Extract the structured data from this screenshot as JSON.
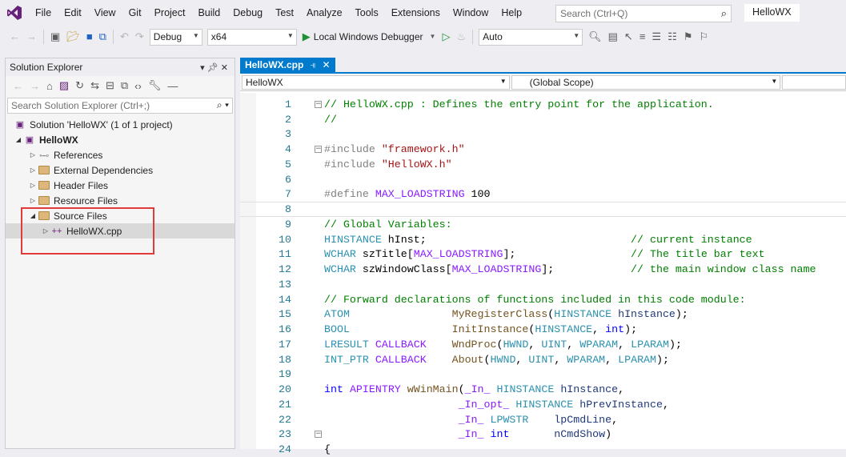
{
  "menubar": {
    "items": [
      "File",
      "Edit",
      "View",
      "Git",
      "Project",
      "Build",
      "Debug",
      "Test",
      "Analyze",
      "Tools",
      "Extensions",
      "Window",
      "Help"
    ],
    "search_placeholder": "Search (Ctrl+Q)",
    "solution_name": "HelloWX"
  },
  "toolbar": {
    "config": "Debug",
    "platform": "x64",
    "run_label": "Local Windows Debugger",
    "auto_label": "Auto"
  },
  "solution_explorer": {
    "title": "Solution Explorer",
    "search_placeholder": "Search Solution Explorer (Ctrl+;)",
    "solution_label": "Solution 'HelloWX' (1 of 1 project)",
    "project_label": "HelloWX",
    "nodes": [
      {
        "label": "References",
        "icon": "references-icon"
      },
      {
        "label": "External Dependencies",
        "icon": "folder-icon"
      },
      {
        "label": "Header Files",
        "icon": "folder-icon"
      },
      {
        "label": "Resource Files",
        "icon": "folder-icon"
      },
      {
        "label": "Source Files",
        "icon": "folder-icon"
      }
    ],
    "selected_file": "HelloWX.cpp"
  },
  "editor": {
    "tab_label": "HelloWX.cpp",
    "nav_project": "HelloWX",
    "nav_scope": "(Global Scope)",
    "line_numbers": [
      "1",
      "2",
      "3",
      "4",
      "5",
      "6",
      "7",
      "8",
      "9",
      "10",
      "11",
      "12",
      "13",
      "14",
      "15",
      "16",
      "17",
      "18",
      "19",
      "20",
      "21",
      "22",
      "23",
      "24"
    ],
    "lines": [
      [
        [
          "c-com",
          "// HelloWX.cpp : Defines the entry point for the application."
        ]
      ],
      [
        [
          "c-com",
          "//"
        ]
      ],
      [],
      [
        [
          "c-pp",
          "#include "
        ],
        [
          "c-str",
          "\"framework.h\""
        ]
      ],
      [
        [
          "c-pp",
          "#include "
        ],
        [
          "c-str",
          "\"HelloWX.h\""
        ]
      ],
      [],
      [
        [
          "c-pp",
          "#define "
        ],
        [
          "c-mac",
          "MAX_LOADSTRING"
        ],
        [
          "c-def",
          " 100"
        ]
      ],
      [],
      [
        [
          "c-com",
          "// Global Variables:"
        ]
      ],
      [
        [
          "c-typ",
          "HINSTANCE"
        ],
        [
          "c-def",
          " hInst;                                "
        ],
        [
          "c-com",
          "// current instance"
        ]
      ],
      [
        [
          "c-typ",
          "WCHAR"
        ],
        [
          "c-def",
          " szTitle["
        ],
        [
          "c-mac",
          "MAX_LOADSTRING"
        ],
        [
          "c-def",
          "];                  "
        ],
        [
          "c-com",
          "// The title bar text"
        ]
      ],
      [
        [
          "c-typ",
          "WCHAR"
        ],
        [
          "c-def",
          " szWindowClass["
        ],
        [
          "c-mac",
          "MAX_LOADSTRING"
        ],
        [
          "c-def",
          "];            "
        ],
        [
          "c-com",
          "// the main window class name"
        ]
      ],
      [],
      [
        [
          "c-com",
          "// Forward declarations of functions included in this code module:"
        ]
      ],
      [
        [
          "c-typ",
          "ATOM"
        ],
        [
          "c-def",
          "                "
        ],
        [
          "c-fn",
          "MyRegisterClass"
        ],
        [
          "c-def",
          "("
        ],
        [
          "c-typ",
          "HINSTANCE"
        ],
        [
          "c-def",
          " "
        ],
        [
          "c-id",
          "hInstance"
        ],
        [
          "c-def",
          ");"
        ]
      ],
      [
        [
          "c-typ",
          "BOOL"
        ],
        [
          "c-def",
          "                "
        ],
        [
          "c-fn",
          "InitInstance"
        ],
        [
          "c-def",
          "("
        ],
        [
          "c-typ",
          "HINSTANCE"
        ],
        [
          "c-def",
          ", "
        ],
        [
          "c-kw",
          "int"
        ],
        [
          "c-def",
          ");"
        ]
      ],
      [
        [
          "c-typ",
          "LRESULT"
        ],
        [
          "c-def",
          " "
        ],
        [
          "c-mac",
          "CALLBACK"
        ],
        [
          "c-def",
          "    "
        ],
        [
          "c-fn",
          "WndProc"
        ],
        [
          "c-def",
          "("
        ],
        [
          "c-typ",
          "HWND"
        ],
        [
          "c-def",
          ", "
        ],
        [
          "c-typ",
          "UINT"
        ],
        [
          "c-def",
          ", "
        ],
        [
          "c-typ",
          "WPARAM"
        ],
        [
          "c-def",
          ", "
        ],
        [
          "c-typ",
          "LPARAM"
        ],
        [
          "c-def",
          ");"
        ]
      ],
      [
        [
          "c-typ",
          "INT_PTR"
        ],
        [
          "c-def",
          " "
        ],
        [
          "c-mac",
          "CALLBACK"
        ],
        [
          "c-def",
          "    "
        ],
        [
          "c-fn",
          "About"
        ],
        [
          "c-def",
          "("
        ],
        [
          "c-typ",
          "HWND"
        ],
        [
          "c-def",
          ", "
        ],
        [
          "c-typ",
          "UINT"
        ],
        [
          "c-def",
          ", "
        ],
        [
          "c-typ",
          "WPARAM"
        ],
        [
          "c-def",
          ", "
        ],
        [
          "c-typ",
          "LPARAM"
        ],
        [
          "c-def",
          ");"
        ]
      ],
      [],
      [
        [
          "c-kw",
          "int"
        ],
        [
          "c-def",
          " "
        ],
        [
          "c-mac",
          "APIENTRY"
        ],
        [
          "c-def",
          " "
        ],
        [
          "c-fn",
          "wWinMain"
        ],
        [
          "c-def",
          "("
        ],
        [
          "c-mac",
          "_In_"
        ],
        [
          "c-def",
          " "
        ],
        [
          "c-typ",
          "HINSTANCE"
        ],
        [
          "c-def",
          " "
        ],
        [
          "c-id",
          "hInstance"
        ],
        [
          "c-def",
          ","
        ]
      ],
      [
        [
          "c-def",
          "                     "
        ],
        [
          "c-mac",
          "_In_opt_"
        ],
        [
          "c-def",
          " "
        ],
        [
          "c-typ",
          "HINSTANCE"
        ],
        [
          "c-def",
          " "
        ],
        [
          "c-id",
          "hPrevInstance"
        ],
        [
          "c-def",
          ","
        ]
      ],
      [
        [
          "c-def",
          "                     "
        ],
        [
          "c-mac",
          "_In_"
        ],
        [
          "c-def",
          " "
        ],
        [
          "c-typ",
          "LPWSTR"
        ],
        [
          "c-def",
          "    "
        ],
        [
          "c-id",
          "lpCmdLine"
        ],
        [
          "c-def",
          ","
        ]
      ],
      [
        [
          "c-def",
          "                     "
        ],
        [
          "c-mac",
          "_In_"
        ],
        [
          "c-def",
          " "
        ],
        [
          "c-kw",
          "int"
        ],
        [
          "c-def",
          "       "
        ],
        [
          "c-id",
          "nCmdShow"
        ],
        [
          "c-def",
          ")"
        ]
      ],
      [
        [
          "c-def",
          "{"
        ]
      ]
    ]
  }
}
